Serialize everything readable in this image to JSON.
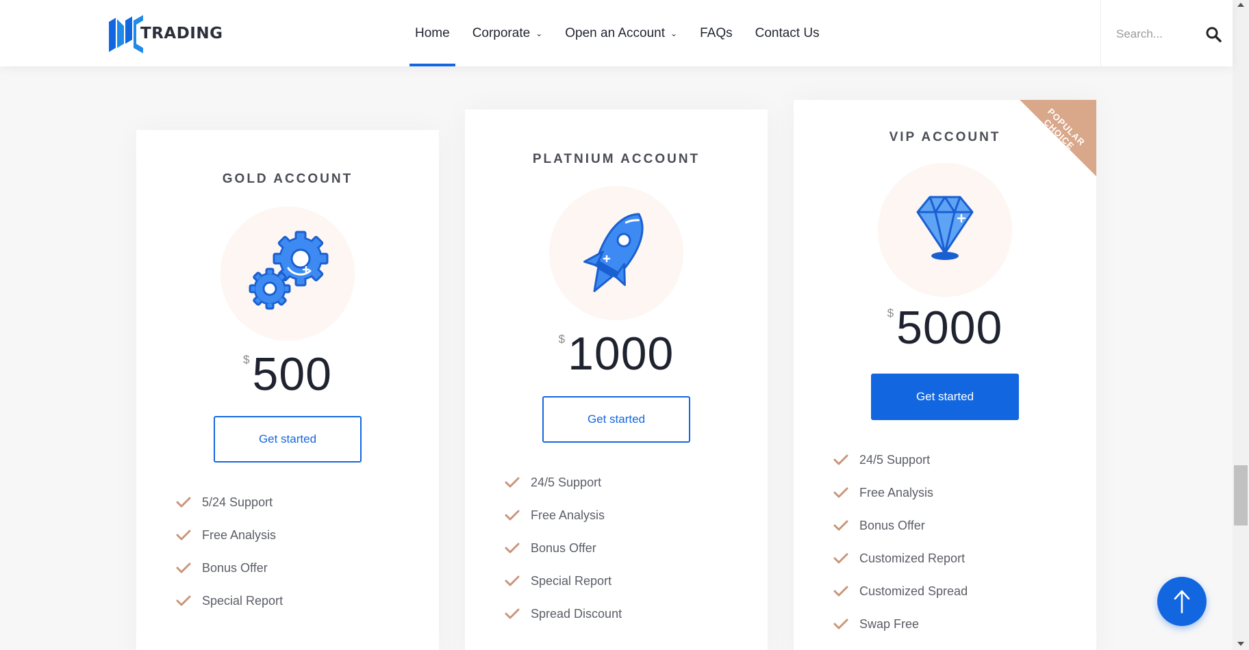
{
  "brand": {
    "name": "TRADING",
    "color": "#1267e0"
  },
  "nav": {
    "items": [
      {
        "label": "Home",
        "active": true,
        "dropdown": false
      },
      {
        "label": "Corporate",
        "active": false,
        "dropdown": true
      },
      {
        "label": "Open an Account",
        "active": false,
        "dropdown": true
      },
      {
        "label": "FAQs",
        "active": false,
        "dropdown": false
      },
      {
        "label": "Contact Us",
        "active": false,
        "dropdown": false
      }
    ]
  },
  "search": {
    "placeholder": "Search...",
    "icon": "search-icon"
  },
  "plans": [
    {
      "title": "GOLD ACCOUNT",
      "icon": "gears-icon",
      "currency": "$",
      "price": "500",
      "button": "Get started",
      "features": [
        "5/24 Support",
        "Free Analysis",
        "Bonus Offer",
        "Special Report"
      ]
    },
    {
      "title": "PLATNIUM ACCOUNT",
      "icon": "rocket-icon",
      "currency": "$",
      "price": "1000",
      "button": "Get started",
      "features": [
        "24/5 Support",
        "Free Analysis",
        "Bonus Offer",
        "Special Report",
        "Spread Discount"
      ]
    },
    {
      "title": "VIP ACCOUNT",
      "icon": "diamond-icon",
      "currency": "$",
      "price": "5000",
      "button": "Get started",
      "ribbon": "POPULAR CHOICE",
      "features": [
        "24/5 Support",
        "Free Analysis",
        "Bonus Offer",
        "Customized Report",
        "Customized Spread",
        "Swap Free"
      ]
    }
  ],
  "colors": {
    "accent": "#1267e0",
    "check": "#c9957a",
    "ribbon": "#d9a789"
  }
}
